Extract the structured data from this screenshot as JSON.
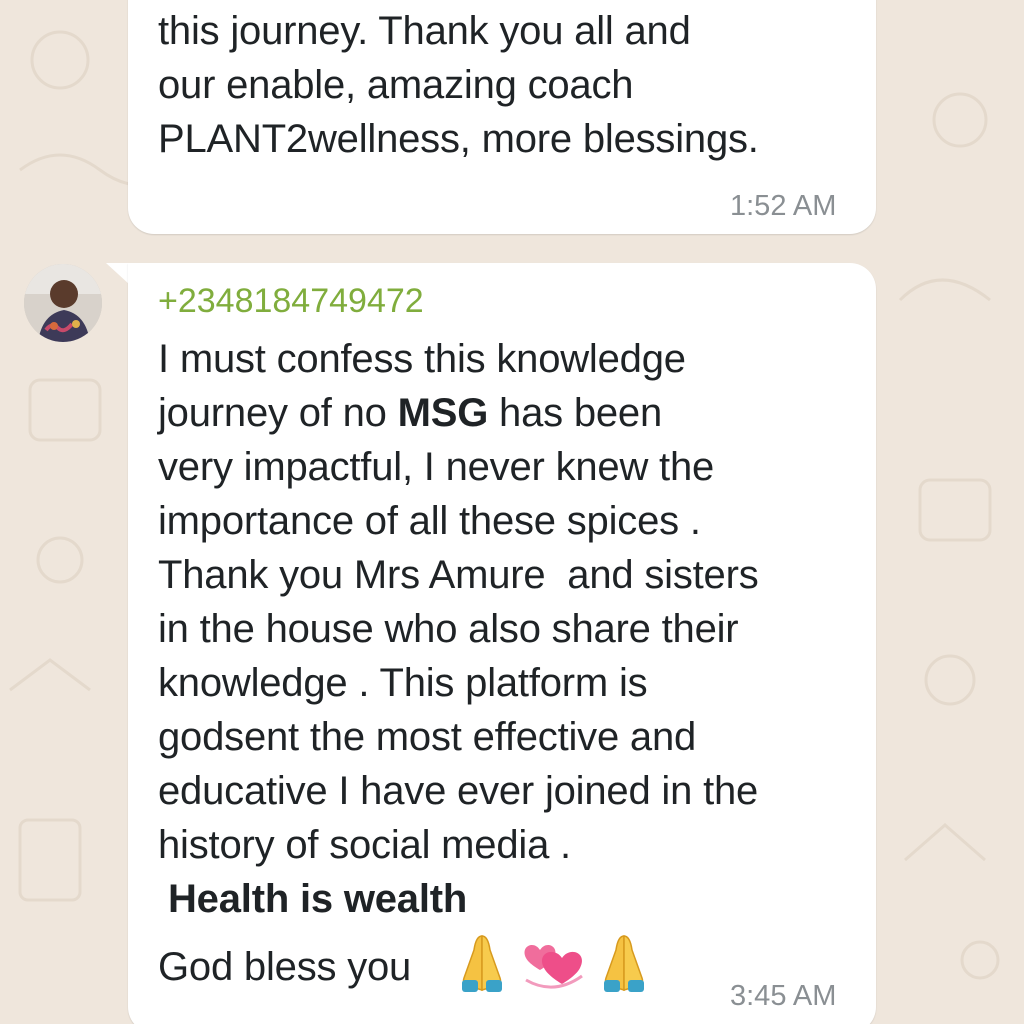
{
  "chat": {
    "messages": [
      {
        "lines": [
          "this journey. Thank you all and",
          "our enable, amazing coach",
          "PLANT2wellness, more blessings."
        ],
        "time": "1:52 AM"
      },
      {
        "sender": "+2348184749472",
        "line1": "I must confess this knowledge",
        "line2_pre": "journey of no ",
        "line2_bold": "MSG",
        "line2_post": " has been",
        "lines_rest": [
          "very impactful, I never knew the",
          "importance of all these spices .",
          "Thank you Mrs Amure  and sisters",
          "in the house who also share their",
          "knowledge . This platform is",
          "godsent the most effective and",
          "educative I have ever joined in the",
          "history of social media ."
        ],
        "bold_line": "Health is wealth",
        "closing": "God bless you",
        "emojis": [
          "folded-hands-emoji",
          "revolving-hearts-emoji",
          "folded-hands-emoji"
        ],
        "time": "3:45 AM"
      }
    ]
  },
  "colors": {
    "wallpaper": "#efe6dc",
    "bubble": "#ffffff",
    "sender": "#80ad3d",
    "timestamp": "#8a8f93",
    "text": "#1f2326"
  }
}
